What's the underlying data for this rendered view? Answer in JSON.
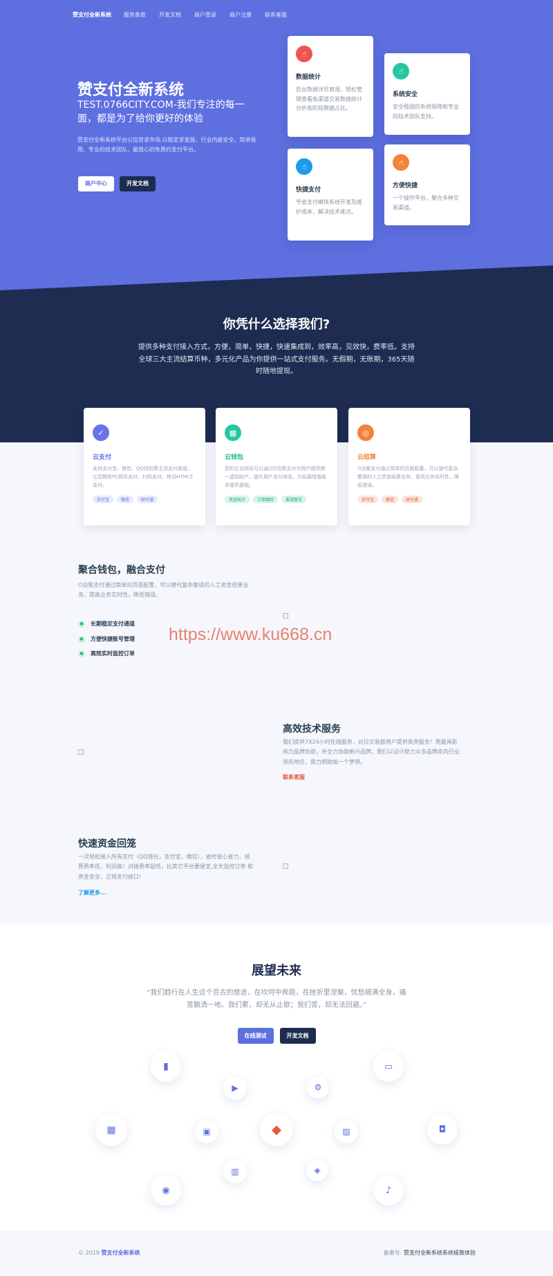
{
  "nav": {
    "brand": "赞支付全新系统",
    "items": [
      "服务条款",
      "开发文档",
      "商户登录",
      "商户注册",
      "联系客服"
    ]
  },
  "hero": {
    "title": "赞支付全新系统",
    "subtitle": "TEST.0766CITY.COM-我们专注的每一面，都是为了给你更好的体验",
    "desc": "赞支付全新系统平台以信誉求市场,以稳定求发展，行业内最安全、简单易用、专业的技术团队，最放心的免费约支付平台。",
    "btn_merchant": "商户中心",
    "btn_docs": "开发文档"
  },
  "feature_cards": [
    {
      "title": "数据统计",
      "desc": "后台数据详尽直观，轻松管理查看各渠道交易数据统计分析各阶段数据占比。",
      "icon": "hand-icon",
      "color": "#ef5350"
    },
    {
      "title": "系统安全",
      "desc": "安全稳固的系统保障和专业的技术团队支持。",
      "icon": "hand-icon",
      "color": "#26c6a0"
    },
    {
      "title": "快捷支付",
      "desc": "节省支付模块系统开发及维护成本，解决技术难点。",
      "icon": "hand-icon",
      "color": "#1e9be8"
    },
    {
      "title": "方便快捷",
      "desc": "一个操作平台，聚合多种交易渠道。",
      "icon": "hand-icon",
      "color": "#f5823a"
    }
  ],
  "why": {
    "title": "你凭什么选择我们?",
    "desc": "提供多种支付接入方式，方便，简单，快捷，快速集成到，效率高，见效快，费率低。支持全球三大主流结算币种，多元化产品为你提供一站式支付服务。无假期，无账期，365天随时随地提现。"
  },
  "service_cards": [
    {
      "title": "云支付",
      "desc": "支持支付宝、微信、QQ钱包等主流支付渠道，让您拥有PC网页支付、扫码支付、移动HTML5支付。",
      "tags": [
        "支付宝",
        "微信",
        "财付通"
      ],
      "icon": "check-icon",
      "color": "#6a72e8",
      "title_color": "#5e6fe0",
      "tag_bg": "#e8eafc",
      "tag_fg": "#5e6fe0"
    },
    {
      "title": "云钱包",
      "desc": "您的企业网站可以通过O泊聚支付为用户提供统一虚拟账户，提升用户支付体验，为拓展增值服务提供基础。",
      "tags": [
        "资金统计",
        "订单跟踪",
        "渠道整合"
      ],
      "icon": "wallet-icon",
      "color": "#26c6a0",
      "title_color": "#1fb88a",
      "tag_bg": "#d7f5ea",
      "tag_fg": "#1fa878"
    },
    {
      "title": "云结算",
      "desc": "O泊聚支付通过简单的页面配置，可以替代复杂繁琐的人工资金结算业务，提高业务实时性，降低错误。",
      "tags": [
        "支付宝",
        "微信",
        "财付通"
      ],
      "icon": "settle-icon",
      "color": "#f5823a",
      "title_color": "#f5823a",
      "tag_bg": "#fde3de",
      "tag_fg": "#e8553a"
    }
  ],
  "block1": {
    "title": "聚合钱包，融合支付",
    "desc": "O泊聚支付通过简单的页面配置，可以替代复杂繁琐的人工资金结算业务，提高业务实时性，降低错误。",
    "checks": [
      "长期稳定支付通道",
      "方便快捷账号管理",
      "高效实时监控订单"
    ]
  },
  "watermark": "https://www.ku668.cn",
  "block2": {
    "title": "高效技术服务",
    "desc": "我们提供7X24小时在线服务，对日交易额用户提供贵宾服务！用最具影响力品牌协助，并全力协助新兴品牌，我们以设计助力众多品牌走向行业领先地位，鼎力相助每一个梦想。",
    "link": "联系客服"
  },
  "block3": {
    "title": "快速资金回笼",
    "desc": "一次轻松接入所有支付（QQ钱包，支付宝，微信），省时省心省力，结算费率低，利润高！对接费率超低，比其它平台要便宜,全天监控订单 和资金安全，正规支付接口!",
    "link": "了解更多..."
  },
  "future": {
    "title": "展望未来",
    "quote": "“我们趋行在人生这个亘古的旅途，在坎坷中奔跑，在挫折里涅槃，忧愁缠满全身，痛苦飘洒一地。我们累，却无从止歇；我们苦，却无法回避。”",
    "btn_test": "在线测试",
    "btn_docs": "开发文档"
  },
  "bubbles": [
    "bar-chart-icon",
    "play-icon",
    "gear-icon",
    "card-icon",
    "calendar-icon",
    "briefcase-icon",
    "sketch-icon",
    "image-icon",
    "bag-icon",
    "building-icon",
    "cube-icon",
    "camera-icon",
    "bell-icon"
  ],
  "footer": {
    "copyright": "© 2019",
    "brand": "赞支付全新系统",
    "record_label": "备案号:",
    "record_value": "赞支付全新系统系统极致体验"
  }
}
